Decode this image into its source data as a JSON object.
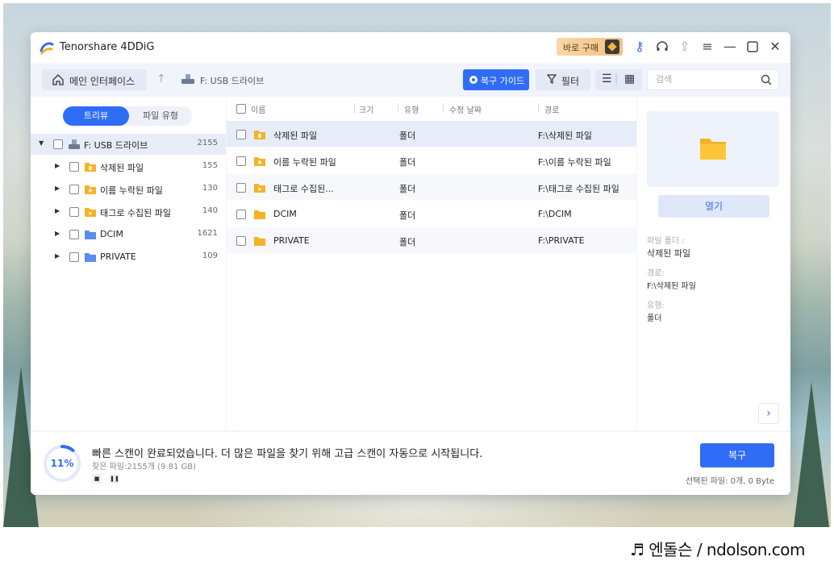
{
  "app": {
    "title": "Tenorshare 4DDiG",
    "buy_label": "바로 구매"
  },
  "toolbar": {
    "home_label": "메인 인터페이스",
    "path": "F: USB 드라이브",
    "guide_label": "복구 가이드",
    "filter_label": "필터",
    "search_placeholder": "검색"
  },
  "sidebar": {
    "tabs": [
      "트리뷰",
      "파일 유형"
    ],
    "root": {
      "label": "F: USB 드라이브",
      "count": "2155"
    },
    "items": [
      {
        "label": "삭제된 파일",
        "count": "155",
        "icon": "deleted-folder-icon"
      },
      {
        "label": "이름 누락된 파일",
        "count": "130",
        "icon": "lost-name-folder-icon"
      },
      {
        "label": "태그로 수집된 파일",
        "count": "140",
        "icon": "tag-folder-icon"
      },
      {
        "label": "DCIM",
        "count": "1621",
        "icon": "blue-folder-icon"
      },
      {
        "label": "PRIVATE",
        "count": "109",
        "icon": "blue-folder-icon"
      }
    ]
  },
  "table": {
    "columns": [
      "이름",
      "크기",
      "유형",
      "수정 날짜",
      "경로"
    ],
    "rows": [
      {
        "name": "삭제된 파일",
        "type": "폴더",
        "path": "F:\\삭제된 파일"
      },
      {
        "name": "이름 누락된 파일",
        "type": "폴더",
        "path": "F:\\이름 누락된 파일"
      },
      {
        "name": "태그로 수집된...",
        "type": "폴더",
        "path": "F:\\태그로 수집된 파일"
      },
      {
        "name": "DCIM",
        "type": "폴더",
        "path": "F:\\DCIM"
      },
      {
        "name": "PRIVATE",
        "type": "폴더",
        "path": "F:\\PRIVATE"
      }
    ]
  },
  "details": {
    "open_label": "열기",
    "folder_key": "파일 폴더 :",
    "folder_value": "삭제된 파일",
    "path_key": "경로:",
    "path_value": "F:\\삭제된 파일",
    "type_key": "유형:",
    "type_value": "폴더"
  },
  "status": {
    "percent": "11%",
    "progress_fraction": 0.11,
    "message": "빠른 스캔이 완료되었습니다. 더 많은 파일을 찾기 위해 고급 스캔이 자동으로 시작됩니다.",
    "found": "찾은 파일:2155개 (9.81 GB)",
    "recover_label": "복구",
    "selected_info": "선택된 파일: 0개, 0 Byte"
  },
  "watermark": "♬ 엔돌슨 / ndolson.com",
  "colors": {
    "accent": "#2f6df6",
    "folder": "#f5b324",
    "blue_folder": "#5b8def"
  }
}
